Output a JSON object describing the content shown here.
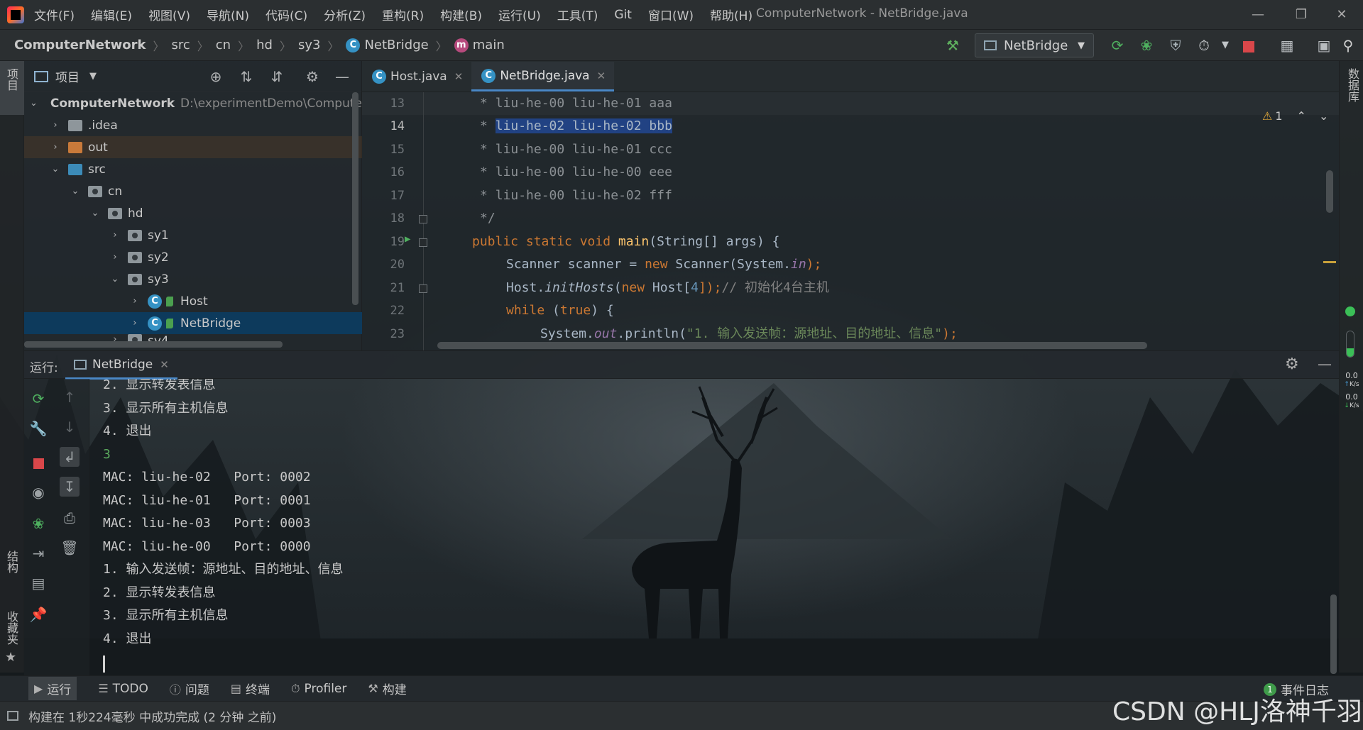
{
  "menu": {
    "items": [
      "文件(F)",
      "编辑(E)",
      "视图(V)",
      "导航(N)",
      "代码(C)",
      "分析(Z)",
      "重构(R)",
      "构建(B)",
      "运行(U)",
      "工具(T)",
      "Git",
      "窗口(W)",
      "帮助(H)"
    ],
    "window_title": "ComputerNetwork - NetBridge.java"
  },
  "breadcrumb": {
    "project": "ComputerNetwork",
    "src": "src",
    "cn": "cn",
    "hd": "hd",
    "sy3": "sy3",
    "class": "NetBridge",
    "method": "main"
  },
  "toolbar": {
    "run_config": "NetBridge"
  },
  "side_tabs": {
    "project": "项目",
    "structure": "结构",
    "favorites": "收藏夹",
    "database": "数据库"
  },
  "project_panel": {
    "title": "项目",
    "tree": [
      {
        "label": "ComputerNetwork",
        "extra": "D:\\experimentDemo\\Compute"
      },
      {
        "label": ".idea"
      },
      {
        "label": "out"
      },
      {
        "label": "src"
      },
      {
        "label": "cn"
      },
      {
        "label": "hd"
      },
      {
        "label": "sy1"
      },
      {
        "label": "sy2"
      },
      {
        "label": "sy3"
      },
      {
        "label": "Host"
      },
      {
        "label": "NetBridge"
      },
      {
        "label": "sy4"
      }
    ]
  },
  "editor": {
    "tabs": [
      {
        "label": "Host.java"
      },
      {
        "label": "NetBridge.java"
      }
    ],
    "warnings": "1",
    "line_numbers": [
      "13",
      "14",
      "15",
      "16",
      "17",
      "18",
      "19",
      "20",
      "21",
      "22",
      "23"
    ],
    "code": {
      "l13": "liu-he-00 liu-he-01 aaa",
      "l14": "liu-he-02 liu-he-02 bbb",
      "l15": "liu-he-00 liu-he-01 ccc",
      "l16": "liu-he-00 liu-he-00 eee",
      "l17": "liu-he-00 liu-he-02 fff",
      "l18": "*/",
      "l19_kw": "public static void",
      "l19_fn": "main",
      "l19_rest": "(String[] args) {",
      "l20_a": "Scanner scanner = ",
      "l20_kw": "new",
      "l20_b": " Scanner(System.",
      "l20_f": "in",
      "l20_c": ");",
      "l21_a": "Host.",
      "l21_fn": "initHosts",
      "l21_b": "(",
      "l21_kw": "new",
      "l21_c": " Host[",
      "l21_num": "4",
      "l21_d": "]);",
      "l21_cm": "// 初始化4台主机",
      "l22_kw": "while",
      "l22_a": " (",
      "l22_kw2": "true",
      "l22_b": ") {",
      "l23_a": "System.",
      "l23_f": "out",
      "l23_b": ".println(",
      "l23_str": "\"1. 输入发送帧：源地址、目的地址、信息\"",
      "l23_c": ");"
    }
  },
  "run_panel": {
    "label": "运行:",
    "tab": "NetBridge",
    "console": [
      "2. 显示转发表信息",
      "3. 显示所有主机信息",
      "4. 退出",
      "3",
      "MAC: liu-he-02   Port: 0002",
      "MAC: liu-he-01   Port: 0001",
      "MAC: liu-he-03   Port: 0003",
      "MAC: liu-he-00   Port: 0000",
      "1. 输入发送帧：源地址、目的地址、信息",
      "2. 显示转发表信息",
      "3. 显示所有主机信息",
      "4. 退出"
    ]
  },
  "network_monitor": {
    "up": "0.0",
    "down": "0.0",
    "unit": "K/s"
  },
  "bottom_tools": {
    "run": "运行",
    "todo": "TODO",
    "problems": "问题",
    "terminal": "终端",
    "profiler": "Profiler",
    "build": "构建",
    "event_log": "事件日志",
    "event_count": "1"
  },
  "status": {
    "message": "构建在 1秒224毫秒 中成功完成 (2 分钟 之前)"
  },
  "watermark": "CSDN @HLJ洛神千羽",
  "colors": {
    "accent": "#4a88c7",
    "selection": "#214283",
    "keyword": "#cc7832",
    "function": "#ffc66d",
    "string": "#6a8759",
    "console_input": "#5cab5e"
  }
}
